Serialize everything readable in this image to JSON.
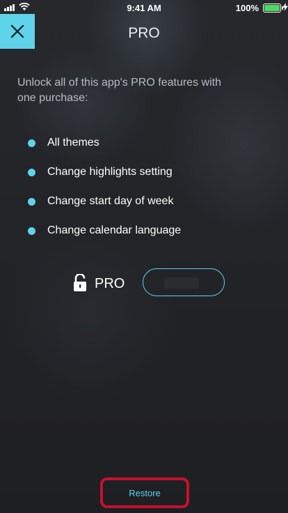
{
  "status_bar": {
    "time": "9:41 AM",
    "battery_percent": "100%"
  },
  "header": {
    "close_icon": "x-icon",
    "title": "PRO"
  },
  "intro_text": "Unlock all of this app's PRO features with one purchase:",
  "features": [
    {
      "label": "All themes"
    },
    {
      "label": "Change highlights setting"
    },
    {
      "label": "Change start day of week"
    },
    {
      "label": "Change calendar language"
    }
  ],
  "purchase": {
    "lock_icon": "unlock-icon",
    "label": "PRO",
    "price": ""
  },
  "footer": {
    "restore_label": "Restore"
  },
  "colors": {
    "accent": "#5fd3ea",
    "background": "#222428",
    "highlight_box": "#c8102e",
    "battery": "#4cd964"
  }
}
